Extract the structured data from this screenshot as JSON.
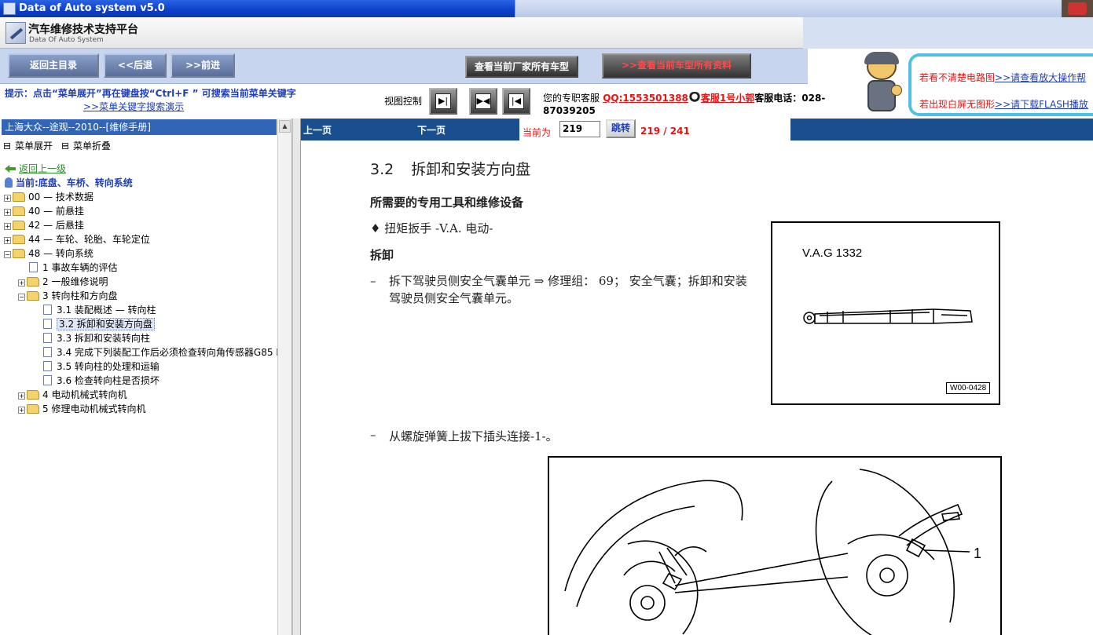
{
  "window": {
    "title": "Data of Auto system v5.0"
  },
  "brand": {
    "name_cn": "汽车维修技术支持平台",
    "name_en": "Data Of Auto System"
  },
  "toolbar": {
    "home": "返回主目录",
    "back": "<<后退",
    "forward": ">>前进",
    "maker_models": "查看当前厂家所有车型",
    "all_data_prefix": ">>",
    "all_data": "查看当前车型所有资料"
  },
  "hint": {
    "text": "提示：点击“菜单展开”再在键盘按“Ctrl+F ” 可搜索当前菜单关键字",
    "link": ">>菜单关键字搜索演示"
  },
  "view_control": {
    "label": "视图控制",
    "btn1": "▶|",
    "btn2": "▶◀",
    "btn3": "|◀"
  },
  "support": {
    "prefix": "您的专职客服",
    "qq": "QQ:1553501388",
    "agent": "客服1号小郭",
    "phone_label": "客服电话：028-",
    "phone": "87039205"
  },
  "ad": {
    "line1_text": "若看不清楚电路图",
    "line1_link": ">>请查看放大操作帮",
    "line2_text": "若出现白屏无图形",
    "line2_link": ">>请下载FLASH播放"
  },
  "sidebar": {
    "header": "上海大众--途观--2010--[维修手册]",
    "expand": "菜单展开",
    "collapse": "菜单折叠",
    "back_up": "返回上一级",
    "current": "当前:底盘、车桥、转向系统",
    "tree": [
      {
        "label": "00 — 技术数据"
      },
      {
        "label": "40 — 前悬挂"
      },
      {
        "label": "42 — 后悬挂"
      },
      {
        "label": "44 — 车轮、轮胎、车轮定位"
      },
      {
        "label": "48 — 转向系统"
      },
      {
        "label": "1 事故车辆的评估"
      },
      {
        "label": "2 一般维修说明"
      },
      {
        "label": "3 转向柱和方向盘"
      },
      {
        "label": "3.1 装配概述 — 转向柱"
      },
      {
        "label": "3.2 拆卸和安装方向盘"
      },
      {
        "label": "3.3 拆卸和安装转向柱"
      },
      {
        "label": "3.4 完成下列装配工作后必须检查转向角传感器G85 I"
      },
      {
        "label": "3.5 转向柱的处理和运输"
      },
      {
        "label": "3.6 检查转向柱是否损坏"
      },
      {
        "label": "4 电动机械式转向机"
      },
      {
        "label": "5 修理电动机械式转向机"
      }
    ]
  },
  "pager": {
    "prev": "上一页",
    "next": "下一页",
    "current_label": "当前为",
    "page": "219",
    "go": "跳转",
    "count": "219 / 241"
  },
  "doc": {
    "section_num": "3.2",
    "section_title": "拆卸和安装方向盘",
    "tools_heading": "所需要的专用工具和维修设备",
    "tool_item": "♦  扭矩扳手 -V.A. 电动-",
    "removal_heading": "拆卸",
    "step1_dash": "–",
    "step1": "拆下驾驶员侧安全气囊单元 ⇒ 修理组： 69； 安全气囊；拆卸和安装驾驶员侧安全气囊单元。",
    "step2_dash": "–",
    "step2": "从螺旋弹簧上拔下插头连接-1-。",
    "figure1_label": "V.A.G 1332",
    "figure1_code": "W00-0428",
    "figure2_callout": "1"
  },
  "colors": {
    "titlebar": "#0b3fc7",
    "pagebar": "#1a4f8f",
    "accent_red": "#e11",
    "link_blue": "#1f3fb8"
  }
}
